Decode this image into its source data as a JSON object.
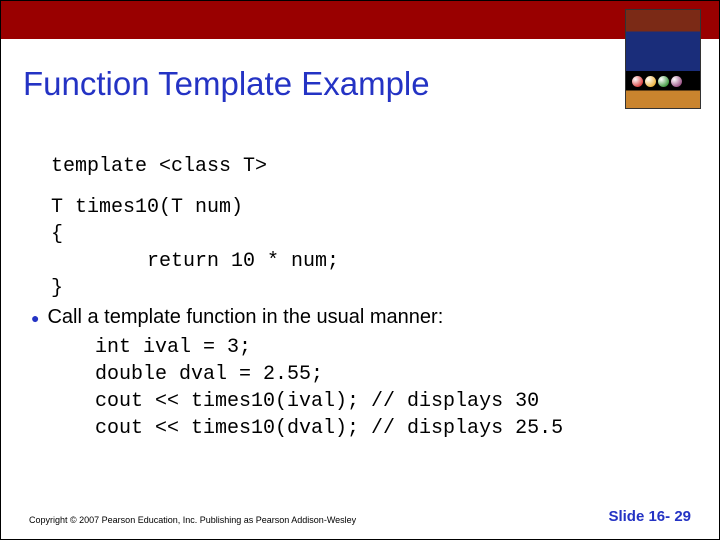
{
  "title": "Function Template Example",
  "code_prefix": "template <class T>",
  "code_def": [
    "T times10(T num)",
    "{",
    "        return 10 * num;",
    "}"
  ],
  "bullet_text": "Call a template function in the usual manner:",
  "code_call": [
    "int ival = 3;",
    "double dval = 2.55;",
    "cout << times10(ival); // displays 30",
    "cout << times10(dval); // displays 25.5"
  ],
  "copyright": "Copyright © 2007 Pearson Education, Inc. Publishing as Pearson Addison-Wesley",
  "page_label": "Slide 16- 29"
}
